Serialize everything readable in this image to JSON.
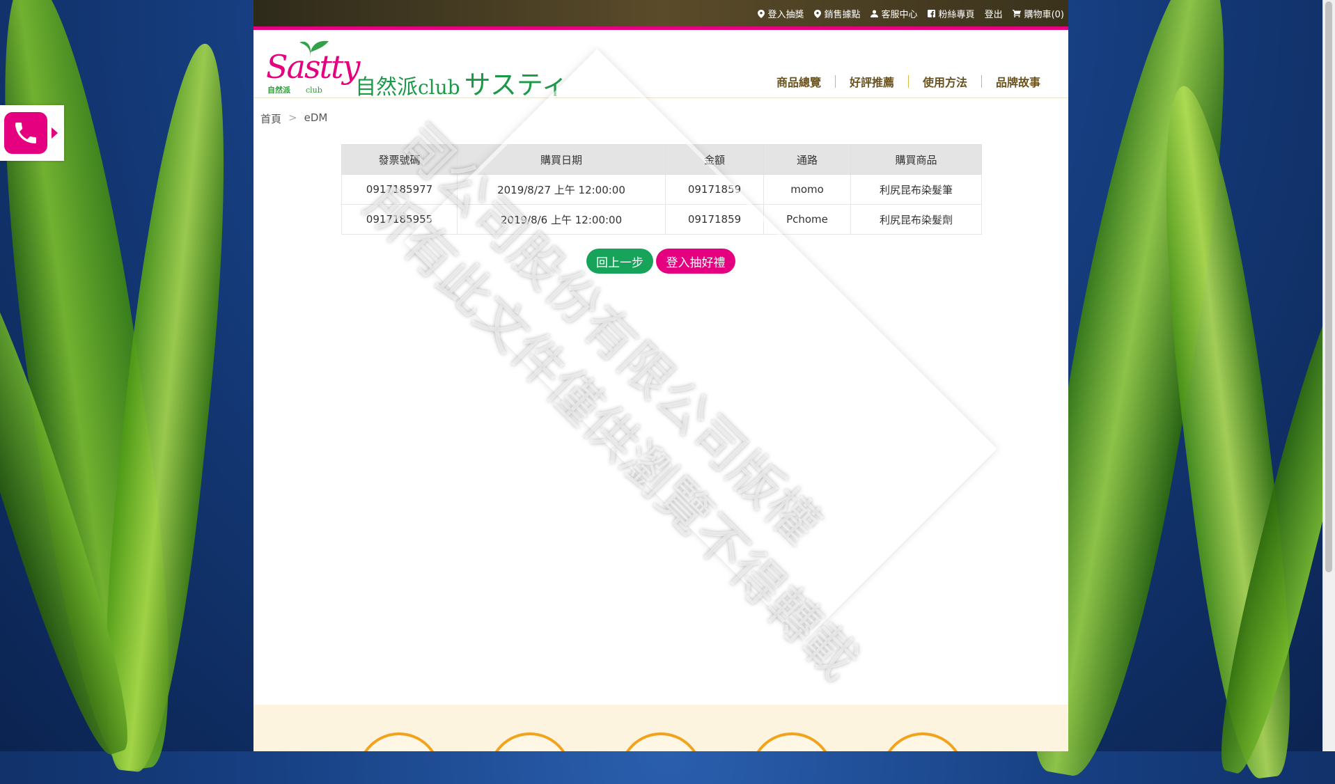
{
  "topnav": [
    {
      "label": "登入抽獎",
      "icon": "location-pin-icon"
    },
    {
      "label": "銷售據點",
      "icon": "location-pin-icon"
    },
    {
      "label": "客服中心",
      "icon": "user-icon"
    },
    {
      "label": "粉絲專頁",
      "icon": "facebook-icon"
    },
    {
      "label": "登出",
      "icon": ""
    },
    {
      "label": "購物車(0)",
      "icon": "cart-icon"
    }
  ],
  "logo": {
    "script": "Sastty",
    "sub_left": "自然派",
    "sub_right": "club",
    "name": "自然派",
    "name_club": "club",
    "name_kana": "サスティ"
  },
  "mainnav": [
    "商品總覽",
    "好評推薦",
    "使用方法",
    "品牌故事"
  ],
  "breadcrumb": {
    "home": "首頁",
    "separator": ">",
    "current": "eDM"
  },
  "table": {
    "headers": [
      "發票號碼",
      "購買日期",
      "金額",
      "通路",
      "購買商品"
    ],
    "rows": [
      [
        "0917185977",
        "2019/8/27 上午 12:00:00",
        "09171859",
        "momo",
        "利尻昆布染髮筆"
      ],
      [
        "0917185955",
        "2019/8/6 上午 12:00:00",
        "09171859",
        "Pchome",
        "利尻昆布染髮劑"
      ]
    ]
  },
  "actions": {
    "back": "回上一步",
    "lottery": "登入抽好禮"
  },
  "watermark": {
    "line1": "司公司股份有限公司版權",
    "line2": "所有此文件僅供瀏覽不得轉載"
  },
  "colors": {
    "brand_pink": "#e4007f",
    "brand_green": "#17a35a",
    "nav_text": "#6b5320"
  }
}
